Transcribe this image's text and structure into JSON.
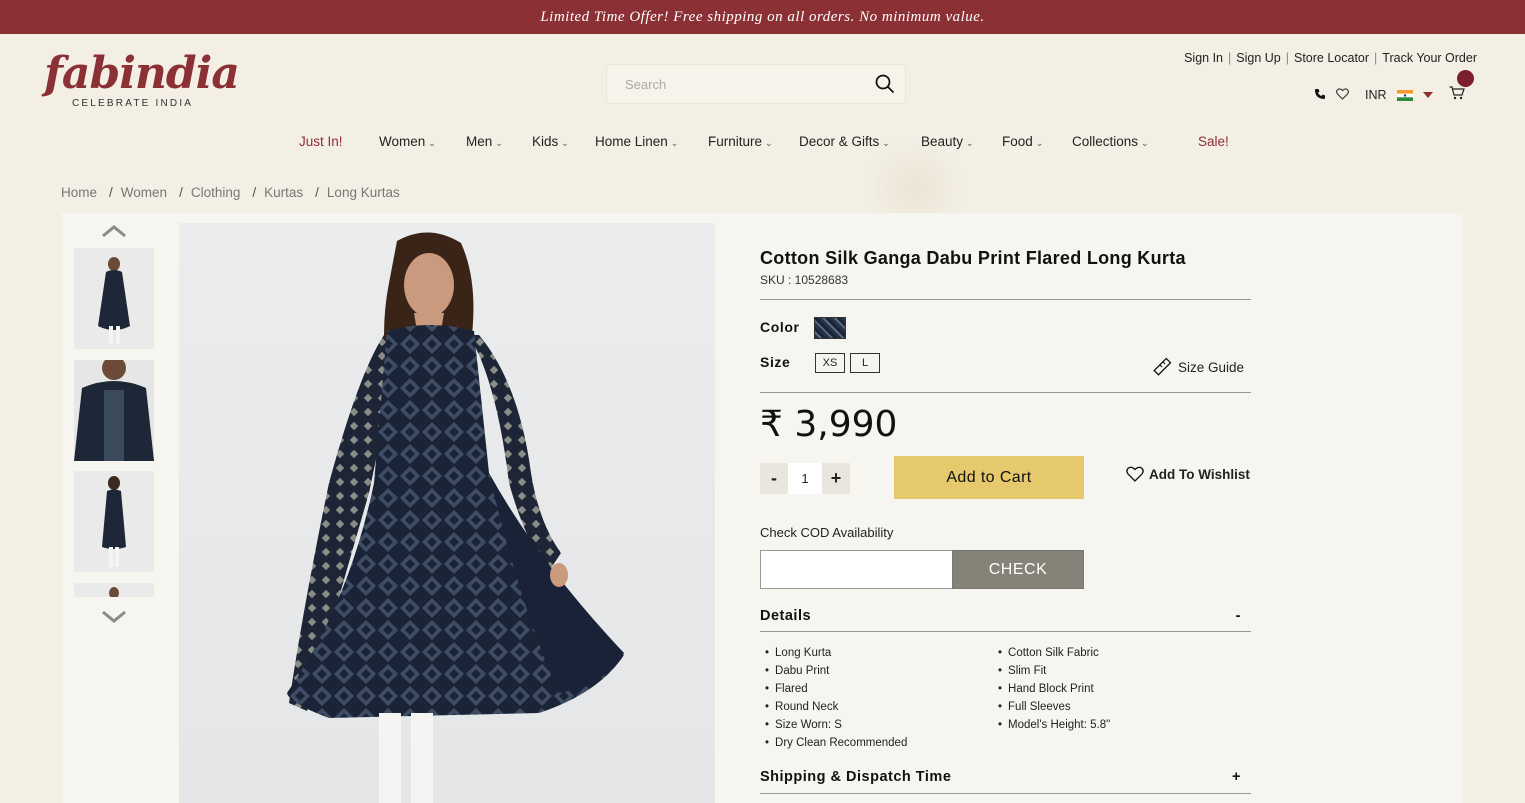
{
  "promo": {
    "text": "Limited Time Offer! Free shipping on all orders. No minimum value."
  },
  "brand": {
    "name": "fabindia",
    "tagline": "CELEBRATE INDIA",
    "color": "#8b3034"
  },
  "search": {
    "placeholder": "Search",
    "value": "",
    "icon": "search-icon"
  },
  "account_links": [
    "Sign In",
    "Sign Up",
    "Store Locator",
    "Track Your Order"
  ],
  "utility": {
    "currency": "INR",
    "icons": [
      "phone-icon",
      "heart-icon",
      "india-flag-icon",
      "cart-icon"
    ]
  },
  "nav": {
    "items": [
      {
        "label": "Just In!",
        "dropdown": false,
        "highlight": true
      },
      {
        "label": "Women",
        "dropdown": true
      },
      {
        "label": "Men",
        "dropdown": true
      },
      {
        "label": "Kids",
        "dropdown": true
      },
      {
        "label": "Home Linen",
        "dropdown": true
      },
      {
        "label": "Furniture",
        "dropdown": true
      },
      {
        "label": "Decor & Gifts",
        "dropdown": true
      },
      {
        "label": "Beauty",
        "dropdown": true
      },
      {
        "label": "Food",
        "dropdown": true
      },
      {
        "label": "Collections",
        "dropdown": true
      },
      {
        "label": "Sale!",
        "dropdown": false,
        "highlight": true
      }
    ]
  },
  "breadcrumb": [
    "Home",
    "Women",
    "Clothing",
    "Kurtas",
    "Long Kurtas"
  ],
  "product": {
    "title": "Cotton Silk Ganga Dabu Print Flared Long Kurta",
    "sku": "SKU : 10528683",
    "color_label": "Color",
    "size_label": "Size",
    "sizes": [
      "XS",
      "L"
    ],
    "size_guide": "Size Guide",
    "price": "₹ 3,990",
    "quantity": "1",
    "qty_minus": "-",
    "qty_plus": "+",
    "add_to_cart": "Add to Cart",
    "wishlist": "Add To Wishlist",
    "cod_label": "Check COD Availability",
    "cod_value": "",
    "check": "CHECK",
    "details_title": "Details",
    "details_toggle": "-",
    "details_left": [
      "Long Kurta",
      "Dabu Print",
      "Flared",
      "Round Neck",
      "Size Worn: S",
      "Dry Clean Recommended"
    ],
    "details_right": [
      "Cotton Silk Fabric",
      "Slim Fit",
      "Hand Block Print",
      "Full Sleeves",
      "Model's Height: 5.8\""
    ],
    "shipping_title": "Shipping & Dispatch Time",
    "shipping_toggle": "+",
    "accent_add_to_cart": "#e6c96c",
    "check_button_color": "#858278"
  },
  "gallery": {
    "thumbnail_count_visible": 4
  }
}
